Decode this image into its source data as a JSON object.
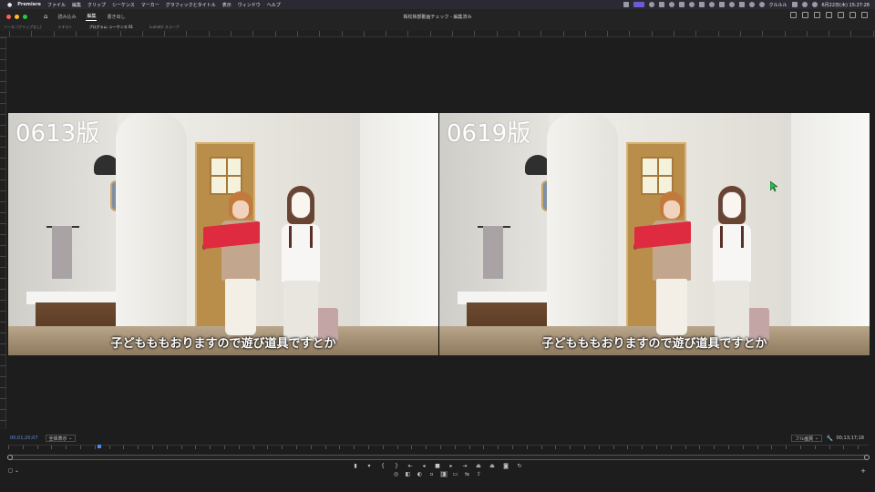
{
  "menubar": {
    "apple": "",
    "app_name": "Premiere",
    "items": [
      "ファイル",
      "編集",
      "クリップ",
      "シーケンス",
      "マーカー",
      "グラフィックとタイトル",
      "表示",
      "ウィンドウ",
      "ヘルプ"
    ],
    "clock": "6月22日(木) 15:27:28",
    "user": "クルルル"
  },
  "titlebar": {
    "workspaces": [
      "読み込み",
      "編集",
      "書き出し"
    ],
    "active_workspace": "編集",
    "document_title": "株松株部動画チェック - 編集済み"
  },
  "panel_tabs": {
    "items": [
      "ソース: (クリップなし)",
      "テキスト",
      "プログラム: シーケンス 01",
      "Lumetri スコープ"
    ],
    "active": "プログラム: シーケンス 01"
  },
  "viewer": {
    "left_label": "0613版",
    "right_label": "0619版",
    "subtitle_left": "子どもももおりますので遊び道具ですとか",
    "subtitle_right": "子どもももおりますので遊び道具ですとか"
  },
  "program_monitor": {
    "timecode_current": "00;01;20;07",
    "fit": "全体表示",
    "quality": "フル画質",
    "timecode_duration": "00;13;17;18"
  },
  "colors": {
    "accent_timecode": "#5c8ee0",
    "panel_bg": "#1c1d1c",
    "cursor": "#22c14a"
  }
}
